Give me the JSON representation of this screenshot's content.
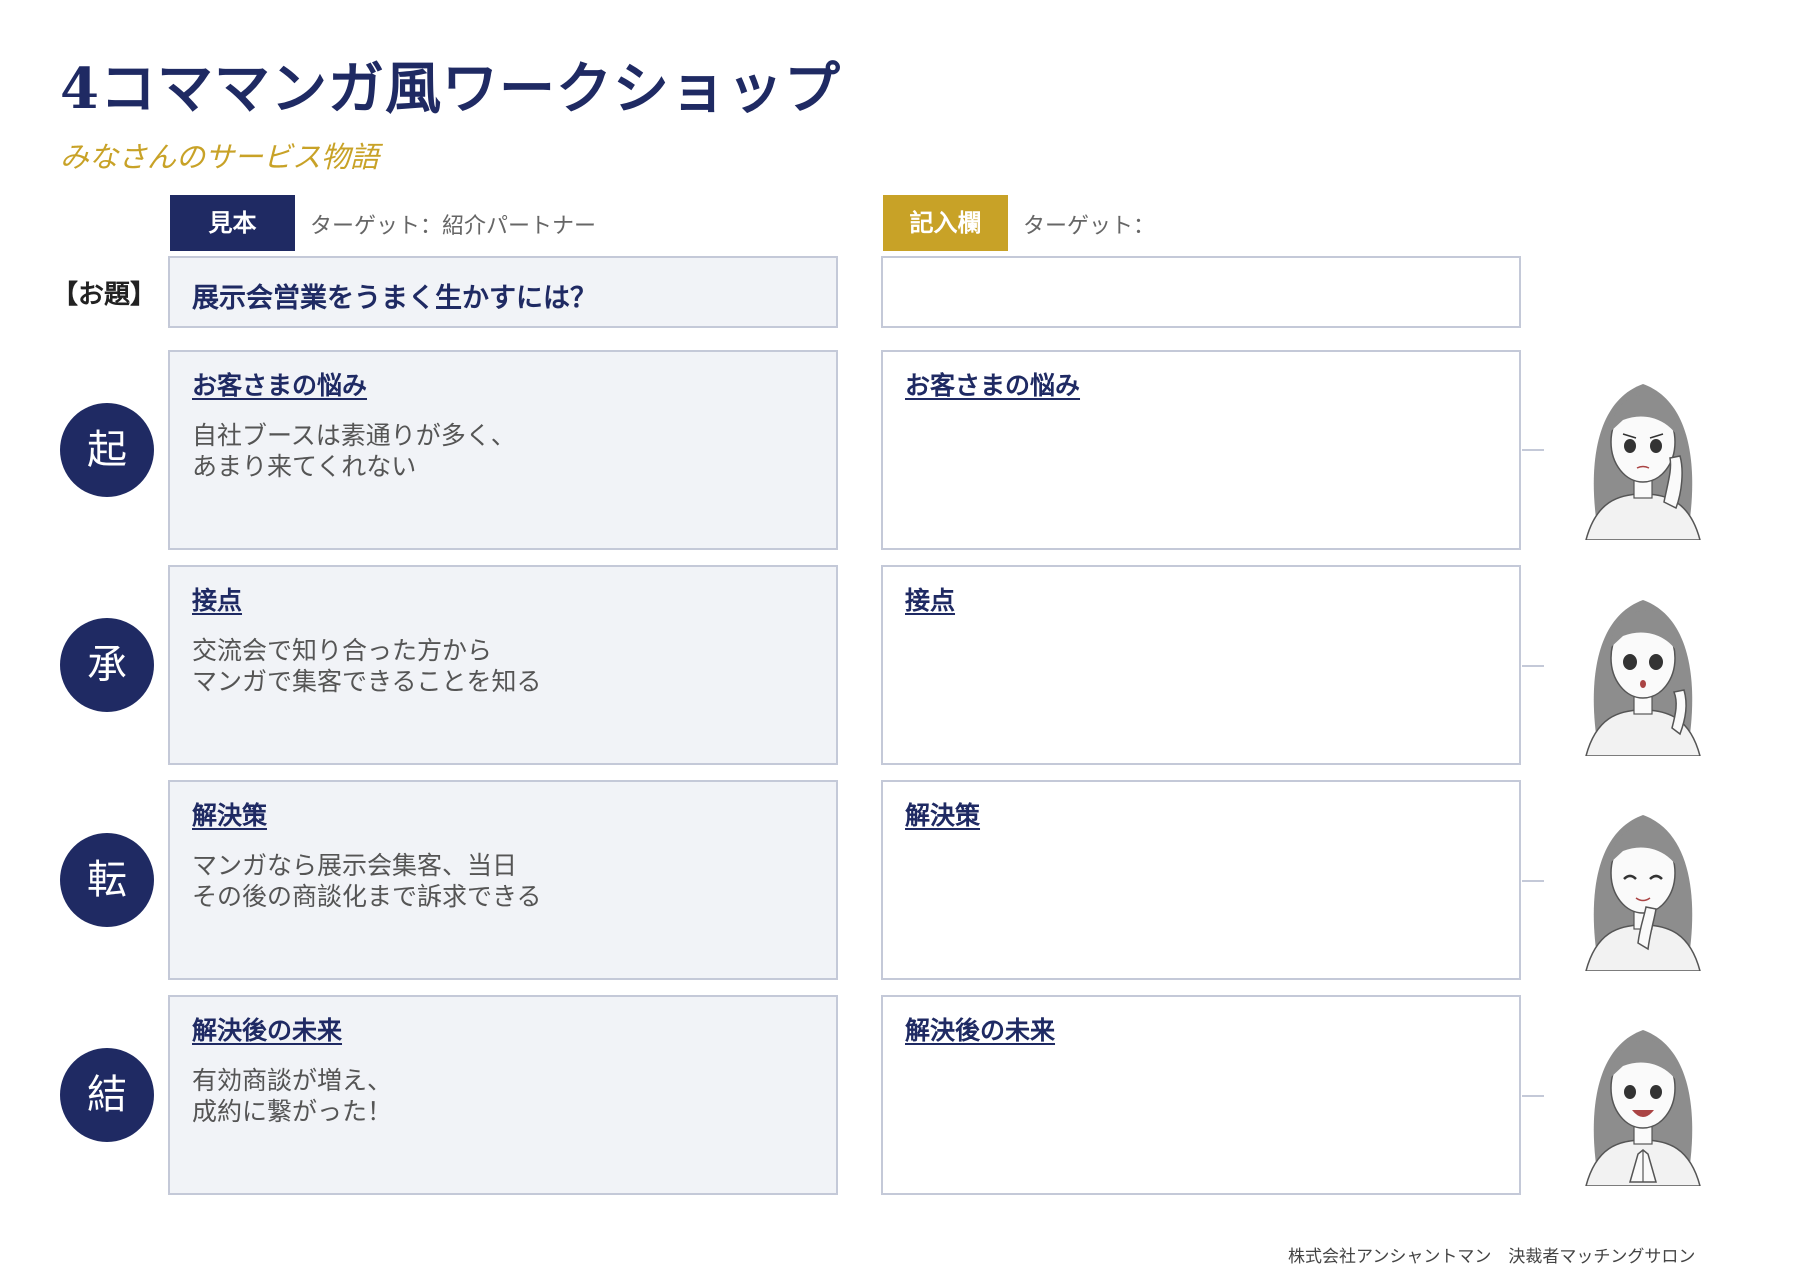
{
  "header": {
    "title": "4コママンガ風ワークショップ",
    "subtitle": "みなさんのサービス物語"
  },
  "columns": {
    "sample": {
      "badge": "見本",
      "target": "ターゲット：紹介パートナー"
    },
    "entry": {
      "badge": "記入欄",
      "target": "ターゲット："
    }
  },
  "topic": {
    "label": "【お題】",
    "sample_text": "展示会営業をうまく生かすには？",
    "entry_text": ""
  },
  "rows": [
    {
      "stage": "起",
      "heading": "お客さまの悩み",
      "lines": [
        "自社ブースは素通りが多く、",
        "あまり来てくれない"
      ],
      "portrait_pose": "cheek-rest"
    },
    {
      "stage": "承",
      "heading": "接点",
      "lines": [
        "交流会で知り合った方から",
        "マンガで集客できることを知る"
      ],
      "portrait_pose": "surprised"
    },
    {
      "stage": "転",
      "heading": "解決策",
      "lines": [
        "マンガなら展示会集客、当日",
        "その後の商談化まで訴求できる"
      ],
      "portrait_pose": "thinking"
    },
    {
      "stage": "結",
      "heading": "解決後の未来",
      "lines": [
        "有効商談が増え、",
        "成約に繋がった！"
      ],
      "portrait_pose": "happy"
    }
  ],
  "footer": "株式会社アンシャントマン　決裁者マッチングサロン",
  "colors": {
    "navy": "#1f2a63",
    "gold": "#c8a227",
    "box_fill": "#f1f3f7",
    "border": "#c4c9d8"
  }
}
